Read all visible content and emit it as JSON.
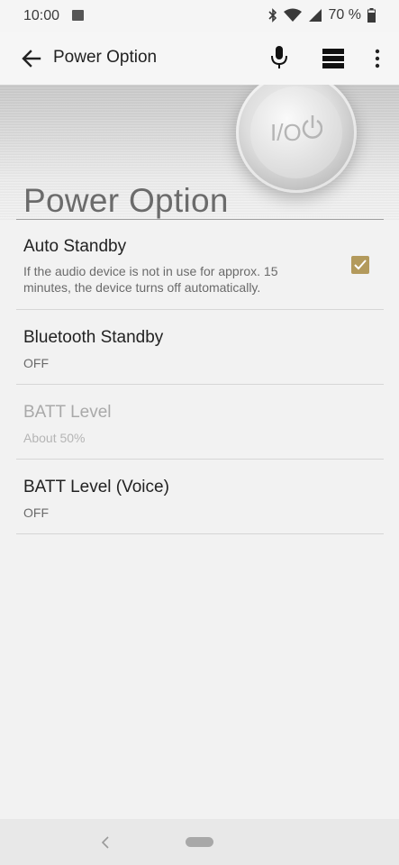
{
  "status_bar": {
    "time": "10:00",
    "battery_percent": "70 %",
    "icons": [
      "image-icon",
      "bluetooth-icon",
      "wifi-icon",
      "signal-icon",
      "battery-icon"
    ]
  },
  "app_bar": {
    "title": "Power Option",
    "icons": [
      "back-arrow-icon",
      "microphone-icon",
      "panel-icon",
      "more-vert-icon"
    ]
  },
  "header": {
    "title": "Power Option",
    "graphic_text": "I/O"
  },
  "settings": {
    "auto_standby": {
      "title": "Auto Standby",
      "description": "If the audio device is not in use for approx. 15 minutes, the device turns off automatically.",
      "checked": true
    },
    "bluetooth_standby": {
      "title": "Bluetooth Standby",
      "value": "OFF"
    },
    "batt_level": {
      "title": "BATT Level",
      "value": "About 50%",
      "disabled": true
    },
    "batt_level_voice": {
      "title": "BATT Level (Voice)",
      "value": "OFF"
    }
  },
  "colors": {
    "accent": "#b39a5c",
    "background": "#f2f2f2",
    "divider": "#d6d6d6"
  }
}
